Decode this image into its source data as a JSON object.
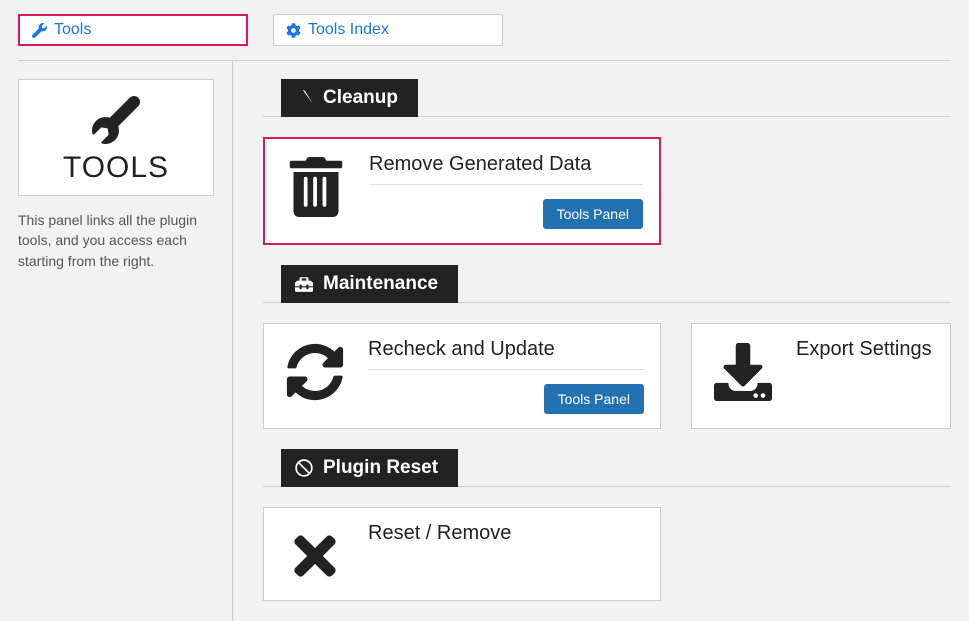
{
  "nav": {
    "tools_label": "Tools",
    "tools_index_label": "Tools Index"
  },
  "sidebar": {
    "title": "TOOLS",
    "desc": "This panel links all the plugin tools, and you access each starting from the right."
  },
  "sections": {
    "cleanup": {
      "header": "Cleanup",
      "cards": [
        {
          "title": "Remove Generated Data",
          "button": "Tools Panel"
        }
      ]
    },
    "maintenance": {
      "header": "Maintenance",
      "cards": [
        {
          "title": "Recheck and Update",
          "button": "Tools Panel"
        },
        {
          "title": "Export Settings"
        }
      ]
    },
    "plugin_reset": {
      "header": "Plugin Reset",
      "cards": [
        {
          "title": "Reset / Remove"
        }
      ]
    }
  }
}
